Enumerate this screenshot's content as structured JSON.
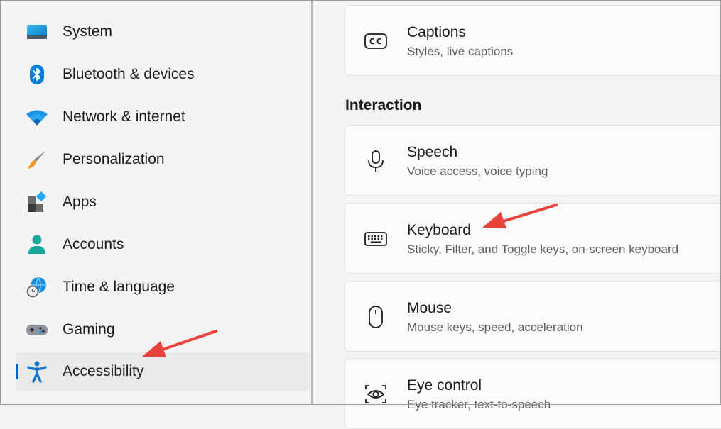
{
  "sidebar": {
    "items": [
      {
        "label": "System",
        "icon": "system-icon"
      },
      {
        "label": "Bluetooth & devices",
        "icon": "bluetooth-icon"
      },
      {
        "label": "Network & internet",
        "icon": "wifi-icon"
      },
      {
        "label": "Personalization",
        "icon": "brush-icon"
      },
      {
        "label": "Apps",
        "icon": "apps-icon"
      },
      {
        "label": "Accounts",
        "icon": "person-icon"
      },
      {
        "label": "Time & language",
        "icon": "globe-clock-icon"
      },
      {
        "label": "Gaming",
        "icon": "gamepad-icon"
      },
      {
        "label": "Accessibility",
        "icon": "accessibility-icon",
        "selected": true
      }
    ]
  },
  "main": {
    "cards": [
      {
        "title": "Captions",
        "subtitle": "Styles, live captions",
        "icon": "cc-icon"
      },
      {
        "title": "Speech",
        "subtitle": "Voice access, voice typing",
        "icon": "microphone-icon"
      },
      {
        "title": "Keyboard",
        "subtitle": "Sticky, Filter, and Toggle keys, on-screen keyboard",
        "icon": "keyboard-icon"
      },
      {
        "title": "Mouse",
        "subtitle": "Mouse keys, speed, acceleration",
        "icon": "mouse-icon"
      },
      {
        "title": "Eye control",
        "subtitle": "Eye tracker, text-to-speech",
        "icon": "eye-control-icon"
      }
    ],
    "section_title": "Interaction"
  },
  "colors": {
    "accent": "#0067c0",
    "annotation_arrow": "#e8423a"
  }
}
